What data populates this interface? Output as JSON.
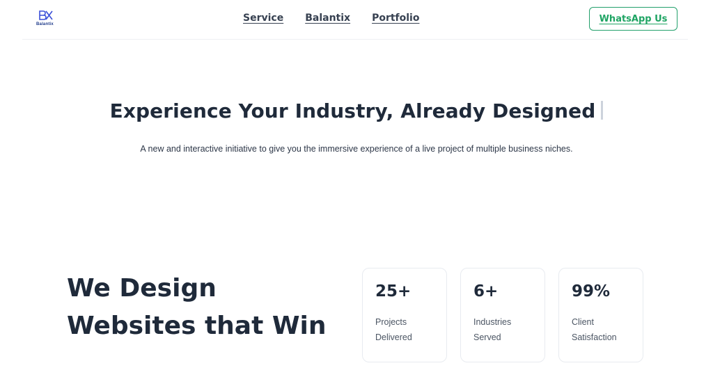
{
  "header": {
    "logo_text": "Balantix",
    "nav": [
      "Service",
      "Balantix",
      "Portfolio"
    ],
    "cta_label": "WhatsApp Us"
  },
  "hero": {
    "title": "Experience Your Industry, Already Designed",
    "subtitle": "A new and interactive initiative to give you the immersive experience of a live project of multiple business niches."
  },
  "design_section": {
    "heading_line1": "We Design",
    "heading_line2": "Websites that Win"
  },
  "stats": [
    {
      "value": "25+",
      "label_line1": "Projects",
      "label_line2": "Delivered"
    },
    {
      "value": "6+",
      "label_line1": "Industries",
      "label_line2": "Served"
    },
    {
      "value": "99%",
      "label_line1": "Client",
      "label_line2": "Satisfaction"
    }
  ],
  "colors": {
    "accent_green": "#1ea463",
    "heading": "#1f2a3a",
    "logo_blue": "#1e3a8a"
  }
}
